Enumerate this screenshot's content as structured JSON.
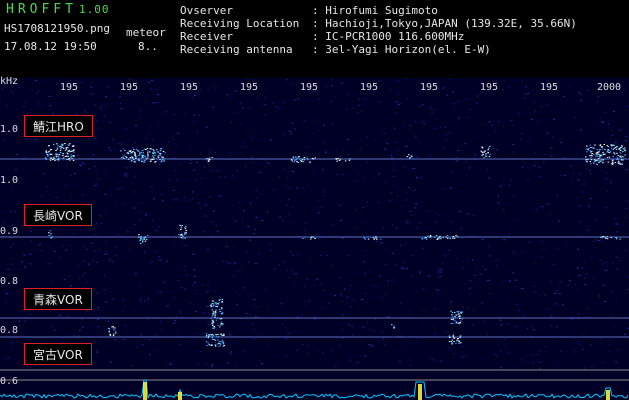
{
  "header": {
    "app_name": "HROFFT",
    "app_version": "1.00",
    "filename": "HS1708121950.png",
    "type": "meteor",
    "datetime": "17.08.12 19:50",
    "marker": "8..",
    "info": [
      {
        "label": "Ovserver",
        "value": ": Hirofumi Sugimoto"
      },
      {
        "label": "Receiving Location",
        "value": ": Hachioji,Tokyo,JAPAN (139.32E, 35.66N)"
      },
      {
        "label": "Receiver",
        "value": ": IC-PCR1000 116.600MHz"
      },
      {
        "label": "Receiving antenna",
        "value": ": 3el-Yagi Horizon(el. E-W)"
      }
    ]
  },
  "axis": {
    "y_unit": "kHz",
    "y_ticks": [
      "1.0",
      "1.0",
      "0.9",
      "0.8",
      "0.8",
      "0.6"
    ],
    "x_ticks": [
      "195",
      "195",
      "195",
      "195",
      "195",
      "195",
      "195",
      "195",
      "195",
      "2000"
    ]
  },
  "stations": [
    "鯖江HRO",
    "長崎VOR",
    "青森VOR",
    "宮古VOR"
  ],
  "colors": {
    "background": "#000026",
    "header_text": "#44dd44",
    "station_border": "#e02020",
    "signal": "#7fe8ff",
    "baseline": "#00c8ff",
    "peak": "#ffff40"
  }
}
